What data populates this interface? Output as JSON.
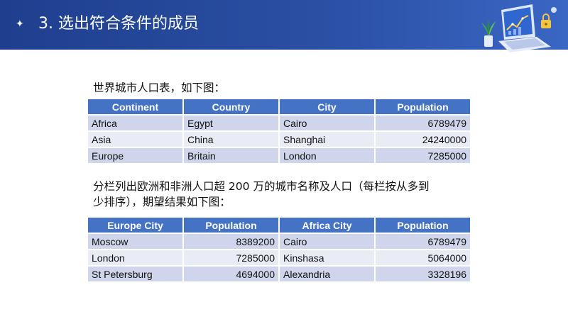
{
  "header": {
    "sparkle": "✦",
    "title": "3. 选出符合条件的成员"
  },
  "intro_text": "世界城市人口表，如下图：",
  "table1": {
    "headers": [
      "Continent",
      "Country",
      "City",
      "Population"
    ],
    "rows": [
      [
        "Africa",
        "Egypt",
        "Cairo",
        "6789479"
      ],
      [
        "Asia",
        "China",
        "Shanghai",
        "24240000"
      ],
      [
        "Europe",
        "Britain",
        "London",
        "7285000"
      ]
    ]
  },
  "task_text": {
    "line1": "分栏列出欧洲和非洲人口超 200 万的城市名称及人口（每栏按从多到",
    "line2": "少排序），期望结果如下图："
  },
  "table2": {
    "headers": [
      "Europe City",
      "Population",
      "Africa City",
      "Population"
    ],
    "rows": [
      [
        "Moscow",
        "8389200",
        "Cairo",
        "6789479"
      ],
      [
        "London",
        "7285000",
        "Kinshasa",
        "5064000"
      ],
      [
        "St Petersburg",
        "4694000",
        "Alexandria",
        "3328196"
      ]
    ]
  },
  "colors": {
    "header_bg": "#2a4fa3",
    "table_header_bg": "#4472c4",
    "row_odd": "#cfd5ea",
    "row_even": "#e9ebf5"
  },
  "icons": [
    "sparkle-icon",
    "laptop-chart-illustration",
    "plant-icon",
    "lock-icon"
  ]
}
